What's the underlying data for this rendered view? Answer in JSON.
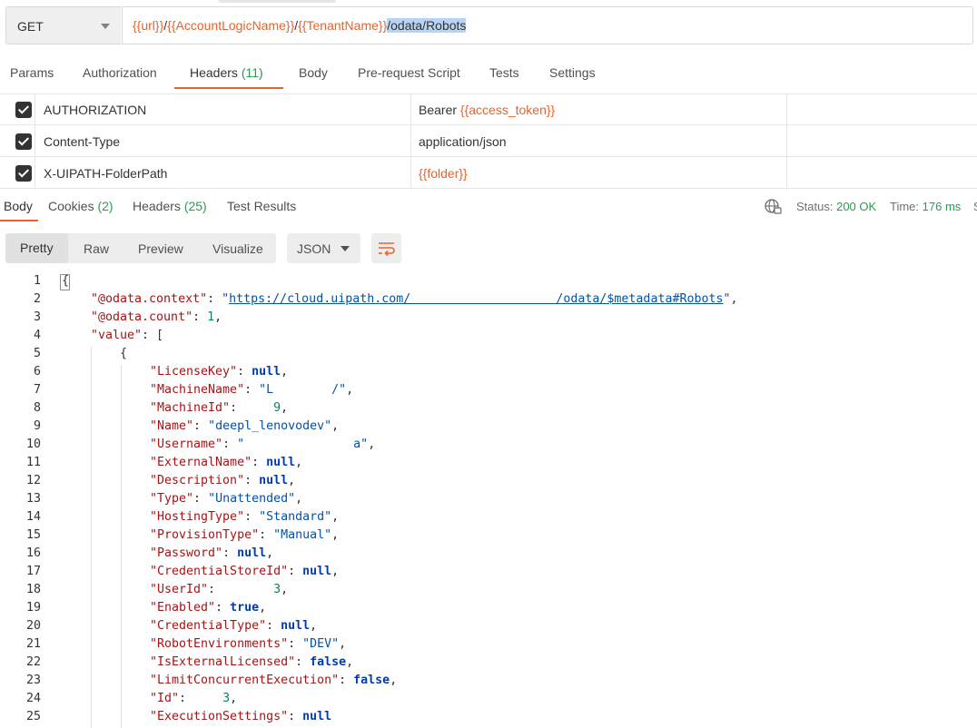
{
  "request": {
    "method": "GET",
    "url": {
      "var1": "{{url}}",
      "sep1": "/",
      "var2": "{{AccountLogicName}}",
      "sep2": "/",
      "var3": "{{TenantName}}",
      "selected": "/odata/Robots"
    }
  },
  "request_tabs": {
    "params": "Params",
    "authorization": "Authorization",
    "headers": "Headers",
    "headers_count": "(11)",
    "body": "Body",
    "prerequest": "Pre-request Script",
    "tests": "Tests",
    "settings": "Settings"
  },
  "headers": [
    {
      "key": "AUTHORIZATION",
      "value_prefix": "Bearer ",
      "value_var": "{{access_token}}",
      "value_plain": ""
    },
    {
      "key": "Content-Type",
      "value_prefix": "",
      "value_var": "",
      "value_plain": "application/json"
    },
    {
      "key": "X-UIPATH-FolderPath",
      "value_prefix": "",
      "value_var": "{{folder}}",
      "value_plain": ""
    }
  ],
  "response_tabs": {
    "body": "Body",
    "cookies": "Cookies",
    "cookies_count": "(2)",
    "headers": "Headers",
    "headers_count": "(25)",
    "test_results": "Test Results"
  },
  "response_meta": {
    "status_label": "Status:",
    "status_value": "200 OK",
    "time_label": "Time:",
    "time_value": "176 ms",
    "more": "S"
  },
  "view_modes": {
    "pretty": "Pretty",
    "raw": "Raw",
    "preview": "Preview",
    "visualize": "Visualize",
    "format": "JSON"
  },
  "icons": {
    "method_dropdown": "chevron-down-icon",
    "globe": "globe-icon",
    "wrap": "wrap-lines-icon",
    "checkbox": "checkbox-checked-icon"
  },
  "colors": {
    "accent": "#e8632b",
    "success": "#2b9a52",
    "json_key": "#a31515",
    "json_string": "#0451a5",
    "json_number": "#098658"
  },
  "code_lines": [
    {
      "n": "1",
      "t": "{"
    },
    {
      "n": "2",
      "t": "\"@odata.context\": \"https://cloud.uipath.com/                    /odata/$metadata#Robots\","
    },
    {
      "n": "3",
      "t": "\"@odata.count\": 1,"
    },
    {
      "n": "4",
      "t": "\"value\": ["
    },
    {
      "n": "5",
      "t": "{"
    },
    {
      "n": "6",
      "t": "\"LicenseKey\": null,"
    },
    {
      "n": "7",
      "t": "\"MachineName\": \"L        /\","
    },
    {
      "n": "8",
      "t": "\"MachineId\":     9,"
    },
    {
      "n": "9",
      "t": "\"Name\": \"deepl_lenovodev\","
    },
    {
      "n": "10",
      "t": "\"Username\": \"               a\","
    },
    {
      "n": "11",
      "t": "\"ExternalName\": null,"
    },
    {
      "n": "12",
      "t": "\"Description\": null,"
    },
    {
      "n": "13",
      "t": "\"Type\": \"Unattended\","
    },
    {
      "n": "14",
      "t": "\"HostingType\": \"Standard\","
    },
    {
      "n": "15",
      "t": "\"ProvisionType\": \"Manual\","
    },
    {
      "n": "16",
      "t": "\"Password\": null,"
    },
    {
      "n": "17",
      "t": "\"CredentialStoreId\": null,"
    },
    {
      "n": "18",
      "t": "\"UserId\":        3,"
    },
    {
      "n": "19",
      "t": "\"Enabled\": true,"
    },
    {
      "n": "20",
      "t": "\"CredentialType\": null,"
    },
    {
      "n": "21",
      "t": "\"RobotEnvironments\": \"DEV\","
    },
    {
      "n": "22",
      "t": "\"IsExternalLicensed\": false,"
    },
    {
      "n": "23",
      "t": "\"LimitConcurrentExecution\": false,"
    },
    {
      "n": "24",
      "t": "\"Id\":     3,"
    },
    {
      "n": "25",
      "t": "\"ExecutionSettings\": null"
    }
  ]
}
